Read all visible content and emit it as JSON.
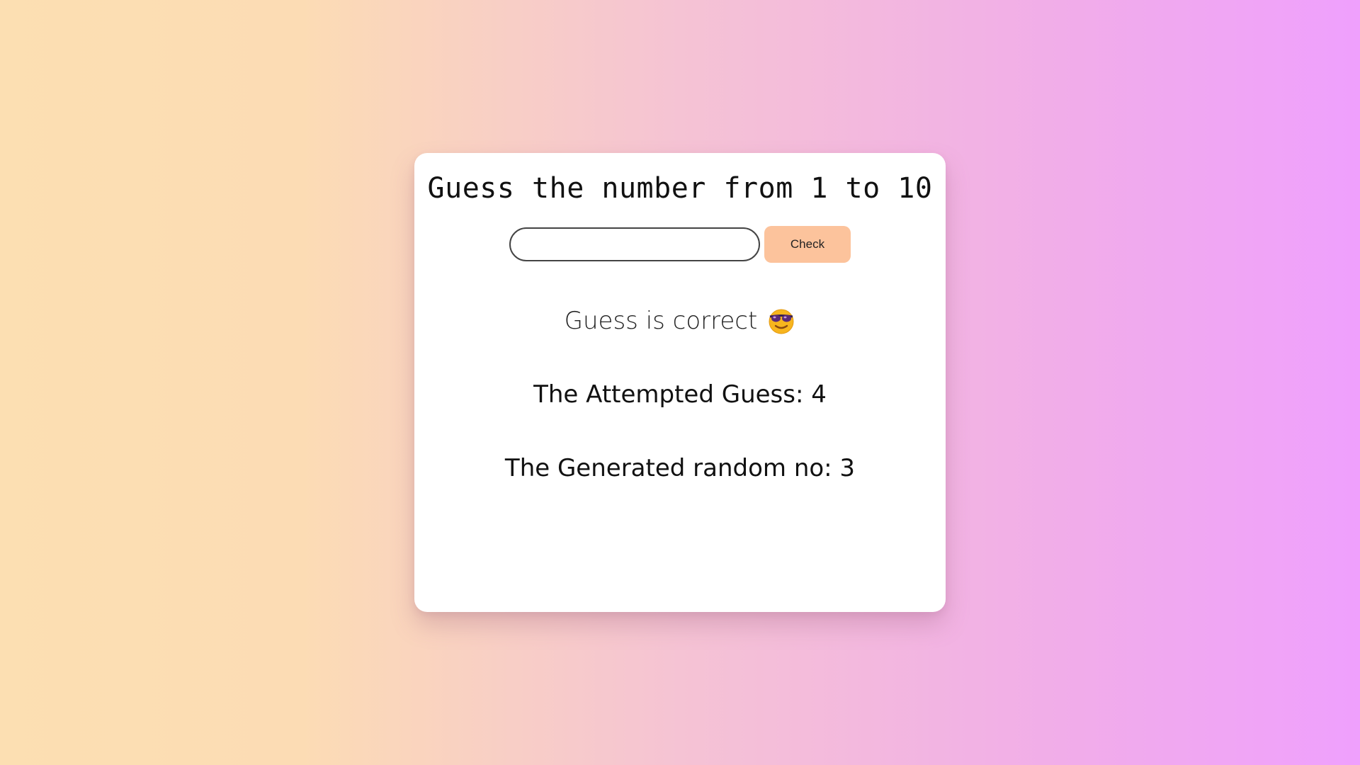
{
  "game": {
    "title": "Guess the number from 1 to 10",
    "input": {
      "value": "",
      "placeholder": ""
    },
    "check_label": "Check",
    "result": {
      "text": "Guess is correct",
      "icon": "smiling-face-with-sunglasses-icon"
    },
    "attempted_label": "The Attempted Guess: 4",
    "generated_label": "The Generated random no: 3"
  },
  "colors": {
    "gradient_start": "#fcdfb2",
    "gradient_end": "#efa0fd",
    "card": "#ffffff",
    "button": "#fcc39c"
  }
}
